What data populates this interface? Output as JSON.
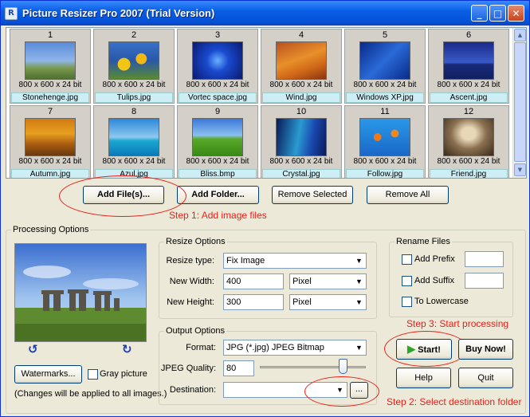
{
  "window": {
    "title": "Picture Resizer Pro 2007 (Trial Version)",
    "controls": [
      "_",
      "□",
      "✕"
    ]
  },
  "thumbnails": [
    {
      "num": "1",
      "dims": "800 x 600 x 24 bit",
      "name": "Stonehenge.jpg",
      "bg": "linear-gradient(#5a8ad8 0%,#8fb5ea 50%,#7a9a50 70%,#4f7030 100%)"
    },
    {
      "num": "2",
      "dims": "800 x 600 x 24 bit",
      "name": "Tulips.jpg",
      "bg": "radial-gradient(circle at 30% 60%,#f5c515 15%,transparent 16%),radial-gradient(circle at 65% 45%,#f0b810 14%,transparent 15%),linear-gradient(#3870c8,#2a58a8 50%,#5a8a30)"
    },
    {
      "num": "3",
      "dims": "800 x 600 x 24 bit",
      "name": "Vortec space.jpg",
      "bg": "radial-gradient(circle,#6ab0ff 0%,#1a4ad0 35%,#0a1a70 100%)"
    },
    {
      "num": "4",
      "dims": "800 x 600 x 24 bit",
      "name": "Wind.jpg",
      "bg": "linear-gradient(160deg,#b85020 0%,#e8902a 45%,#d06818 70%,#8a3510 100%)"
    },
    {
      "num": "5",
      "dims": "800 x 600 x 24 bit",
      "name": "Windows XP.jpg",
      "bg": "linear-gradient(135deg,#0a2a8a,#2a6ad8 50%,#0a2a8a)"
    },
    {
      "num": "6",
      "dims": "800 x 600 x 24 bit",
      "name": "Ascent.jpg",
      "bg": "linear-gradient(#1a2a8a,#3a5ac8 55%,#1a2a7a 60%,#102060)"
    },
    {
      "num": "7",
      "dims": "800 x 600 x 24 bit",
      "name": "Autumn.jpg",
      "bg": "linear-gradient(#d07a10,#e8a020 40%,#a85a10 70%,#6a3a10)"
    },
    {
      "num": "8",
      "dims": "800 x 600 x 24 bit",
      "name": "Azul.jpg",
      "bg": "linear-gradient(#2a88d8,#8ec8f0 50%,#1aa8d0 60%,#0a7ab8)"
    },
    {
      "num": "9",
      "dims": "800 x 600 x 24 bit",
      "name": "Bliss.bmp",
      "bg": "linear-gradient(#3a78d8 0%,#8ac0f0 45%,#58a828 55%,#3a8a18 100%)"
    },
    {
      "num": "10",
      "dims": "800 x 600 x 24 bit",
      "name": "Crystal.jpg",
      "bg": "linear-gradient(100deg,#0a1a5a,#2a9ad0 45%,#1a4ab0 70%,#0a1a5a)"
    },
    {
      "num": "11",
      "dims": "800 x 600 x 24 bit",
      "name": "Follow.jpg",
      "bg": "radial-gradient(circle at 35% 50%,#f07818 10%,transparent 11%),radial-gradient(circle at 70% 40%,#f08820 9%,transparent 10%),linear-gradient(#2a98e8,#1a68c8)"
    },
    {
      "num": "12",
      "dims": "800 x 600 x 24 bit",
      "name": "Friend.jpg",
      "bg": "radial-gradient(ellipse at 50% 40%,#e8d8b8 20%,#8a7050 50%,#3a2a1a 100%)"
    }
  ],
  "buttons": {
    "add_files": "Add File(s)...",
    "add_folder": "Add Folder...",
    "remove_selected": "Remove Selected",
    "remove_all": "Remove All",
    "watermarks": "Watermarks...",
    "start": "Start!",
    "buy_now": "Buy Now!",
    "help": "Help",
    "quit": "Quit",
    "browse": "..."
  },
  "steps": {
    "step1": "Step 1: Add image files",
    "step2": "Step 2: Select destination folder",
    "step3": "Step 3: Start processing"
  },
  "processing": {
    "label": "Processing Options",
    "gray_picture": "Gray picture",
    "note": "(Changes will be applied to all images.)",
    "gray_checked": false
  },
  "resize": {
    "label": "Resize Options",
    "type_label": "Resize type:",
    "type_value": "Fix Image",
    "width_label": "New Width:",
    "width_value": "400",
    "width_unit": "Pixel",
    "height_label": "New Height:",
    "height_value": "300",
    "height_unit": "Pixel"
  },
  "output": {
    "label": "Output Options",
    "format_label": "Format:",
    "format_value": "JPG (*.jpg) JPEG Bitmap",
    "quality_label": "JPEG Quality:",
    "quality_value": "80",
    "destination_label": "Destination:",
    "destination_value": ""
  },
  "rename": {
    "label": "Rename Files",
    "add_prefix": "Add Prefix",
    "add_suffix": "Add Suffix",
    "to_lowercase": "To Lowercase",
    "prefix_value": "",
    "suffix_value": ""
  },
  "colors": {
    "accent_red": "#e8211a",
    "titlebar": "#0a5fe6",
    "start_arrow": "#28a828"
  },
  "icons": {
    "dropdown": "▼",
    "rotate_left": "↺",
    "rotate_right": "↻",
    "scroll_up": "▲",
    "scroll_down": "▼",
    "play": "▶"
  }
}
